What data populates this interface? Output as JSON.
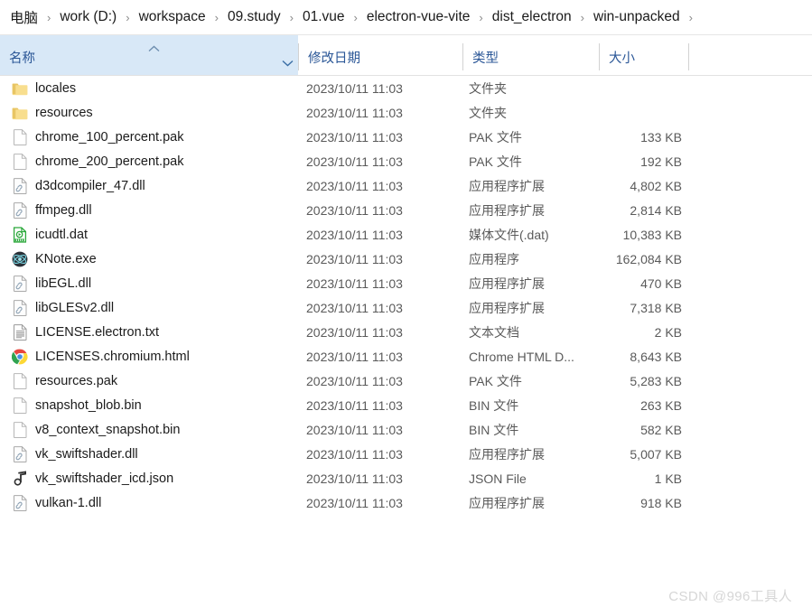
{
  "breadcrumb": {
    "separator": "›",
    "items": [
      {
        "label": "电脑"
      },
      {
        "label": "work (D:)"
      },
      {
        "label": "workspace"
      },
      {
        "label": "09.study"
      },
      {
        "label": "01.vue"
      },
      {
        "label": "electron-vue-vite"
      },
      {
        "label": "dist_electron"
      },
      {
        "label": "win-unpacked"
      }
    ]
  },
  "columns": {
    "name": "名称",
    "date_modified": "修改日期",
    "type": "类型",
    "size": "大小",
    "sort_caret": "︿",
    "name_chevron": "⌄"
  },
  "colors": {
    "header_text": "#2b5797",
    "sorted_header_bg": "#d8e8f7",
    "folder": "#f4d67a",
    "watermark": "#d6d6d6"
  },
  "files": [
    {
      "icon": "folder-icon",
      "name": "locales",
      "date": "2023/10/11 11:03",
      "type": "文件夹",
      "size": ""
    },
    {
      "icon": "folder-icon",
      "name": "resources",
      "date": "2023/10/11 11:03",
      "type": "文件夹",
      "size": ""
    },
    {
      "icon": "blank-file-icon",
      "name": "chrome_100_percent.pak",
      "date": "2023/10/11 11:03",
      "type": "PAK 文件",
      "size": "133 KB"
    },
    {
      "icon": "blank-file-icon",
      "name": "chrome_200_percent.pak",
      "date": "2023/10/11 11:03",
      "type": "PAK 文件",
      "size": "192 KB"
    },
    {
      "icon": "dll-file-icon",
      "name": "d3dcompiler_47.dll",
      "date": "2023/10/11 11:03",
      "type": "应用程序扩展",
      "size": "4,802 KB"
    },
    {
      "icon": "dll-file-icon",
      "name": "ffmpeg.dll",
      "date": "2023/10/11 11:03",
      "type": "应用程序扩展",
      "size": "2,814 KB"
    },
    {
      "icon": "media-file-icon",
      "name": "icudtl.dat",
      "date": "2023/10/11 11:03",
      "type": "媒体文件(.dat)",
      "size": "10,383 KB"
    },
    {
      "icon": "electron-app-icon",
      "name": "KNote.exe",
      "date": "2023/10/11 11:03",
      "type": "应用程序",
      "size": "162,084 KB"
    },
    {
      "icon": "dll-file-icon",
      "name": "libEGL.dll",
      "date": "2023/10/11 11:03",
      "type": "应用程序扩展",
      "size": "470 KB"
    },
    {
      "icon": "dll-file-icon",
      "name": "libGLESv2.dll",
      "date": "2023/10/11 11:03",
      "type": "应用程序扩展",
      "size": "7,318 KB"
    },
    {
      "icon": "text-file-icon",
      "name": "LICENSE.electron.txt",
      "date": "2023/10/11 11:03",
      "type": "文本文档",
      "size": "2 KB"
    },
    {
      "icon": "chrome-icon",
      "name": "LICENSES.chromium.html",
      "date": "2023/10/11 11:03",
      "type": "Chrome HTML D...",
      "size": "8,643 KB"
    },
    {
      "icon": "blank-file-icon",
      "name": "resources.pak",
      "date": "2023/10/11 11:03",
      "type": "PAK 文件",
      "size": "5,283 KB"
    },
    {
      "icon": "blank-file-icon",
      "name": "snapshot_blob.bin",
      "date": "2023/10/11 11:03",
      "type": "BIN 文件",
      "size": "263 KB"
    },
    {
      "icon": "blank-file-icon",
      "name": "v8_context_snapshot.bin",
      "date": "2023/10/11 11:03",
      "type": "BIN 文件",
      "size": "582 KB"
    },
    {
      "icon": "dll-file-icon",
      "name": "vk_swiftshader.dll",
      "date": "2023/10/11 11:03",
      "type": "应用程序扩展",
      "size": "5,007 KB"
    },
    {
      "icon": "json-file-icon",
      "name": "vk_swiftshader_icd.json",
      "date": "2023/10/11 11:03",
      "type": "JSON File",
      "size": "1 KB"
    },
    {
      "icon": "dll-file-icon",
      "name": "vulkan-1.dll",
      "date": "2023/10/11 11:03",
      "type": "应用程序扩展",
      "size": "918 KB"
    }
  ],
  "watermark": "CSDN @996工具人"
}
